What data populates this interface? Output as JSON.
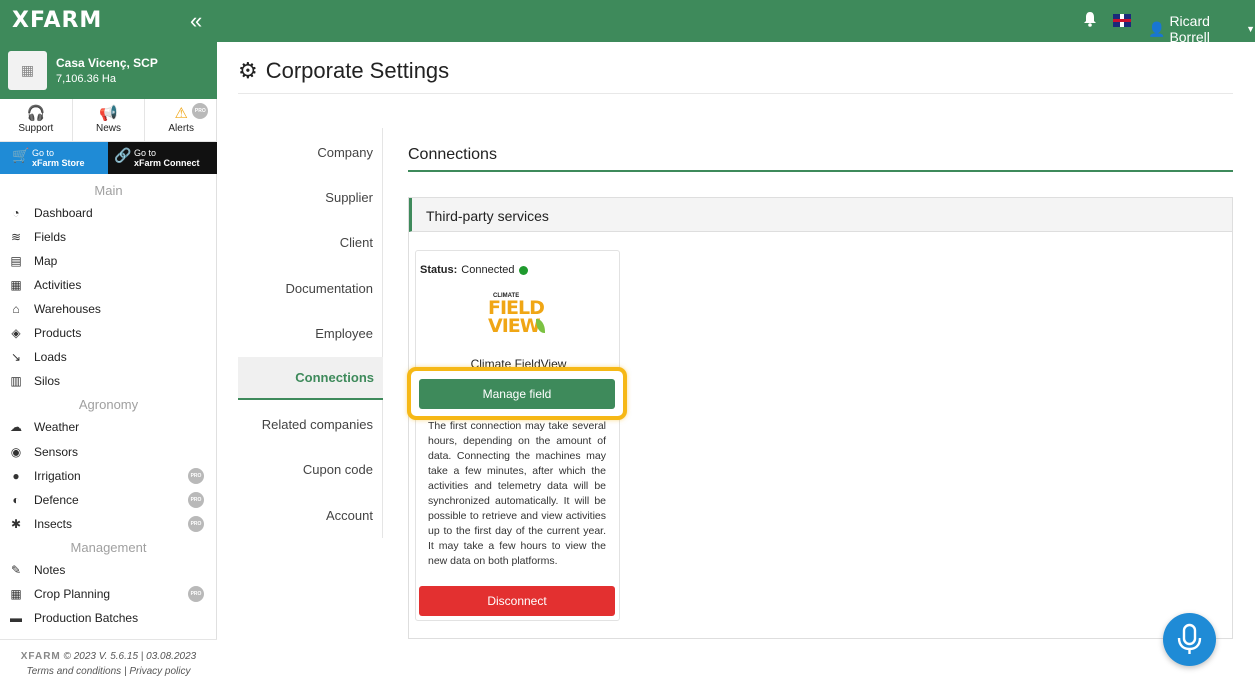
{
  "topbar": {
    "logo": "XFARM",
    "collapse_icon": "chevron-double-left-icon",
    "user_name": "Ricard Borrell"
  },
  "farm": {
    "name": "Casa Vicenç, SCP",
    "area": "7,106.36 Ha"
  },
  "quick": [
    {
      "label": "Support",
      "icon": "support-icon"
    },
    {
      "label": "News",
      "icon": "megaphone-icon"
    },
    {
      "label": "Alerts",
      "icon": "alert-icon",
      "badge": "PRO"
    }
  ],
  "store": {
    "line1": "Go to",
    "line2": "xFarm Store"
  },
  "connect": {
    "line1": "Go to",
    "line2": "xFarm Connect"
  },
  "sections": {
    "main": "Main",
    "agronomy": "Agronomy",
    "management": "Management"
  },
  "nav": {
    "main": [
      "Dashboard",
      "Fields",
      "Map",
      "Activities",
      "Warehouses",
      "Products",
      "Loads",
      "Silos"
    ],
    "agronomy": [
      "Weather",
      "Sensors",
      "Irrigation",
      "Defence",
      "Insects"
    ],
    "management": [
      "Notes",
      "Crop Planning",
      "Production Batches"
    ]
  },
  "pro_label": "PRO",
  "footer": {
    "logo": "XFARM",
    "version": "© 2023 V. 5.6.15 | 03.08.2023",
    "terms": "Terms and conditions",
    "privacy": "Privacy policy"
  },
  "page": {
    "title": "Corporate Settings"
  },
  "subnav": [
    "Company",
    "Supplier",
    "Client",
    "Documentation",
    "Employee",
    "Connections",
    "Related companies",
    "Cupon code",
    "Account"
  ],
  "connections": {
    "title": "Connections",
    "panel_title": "Third-party services",
    "card": {
      "status_label": "Status:",
      "status_value": "Connected",
      "status_color": "#1f9a2e",
      "logo_small": "CLIMATE",
      "logo_line1": "FIELD",
      "logo_line2": "VIEW",
      "service_name": "Climate FieldView",
      "manage_label": "Manage field",
      "description": "The first connection may take several hours, depending on the amount of data. Connecting the machines may take a few minutes, after which the activities and telemetry data will be synchronized automatically. It will be possible to retrieve and view activities up to the first day of the current year. It may take a few hours to view the new data on both platforms.",
      "disconnect_label": "Disconnect"
    }
  },
  "colors": {
    "brand": "#3e8a5b",
    "highlight": "#f6b816",
    "danger": "#e33030",
    "store": "#1f8bd6"
  }
}
